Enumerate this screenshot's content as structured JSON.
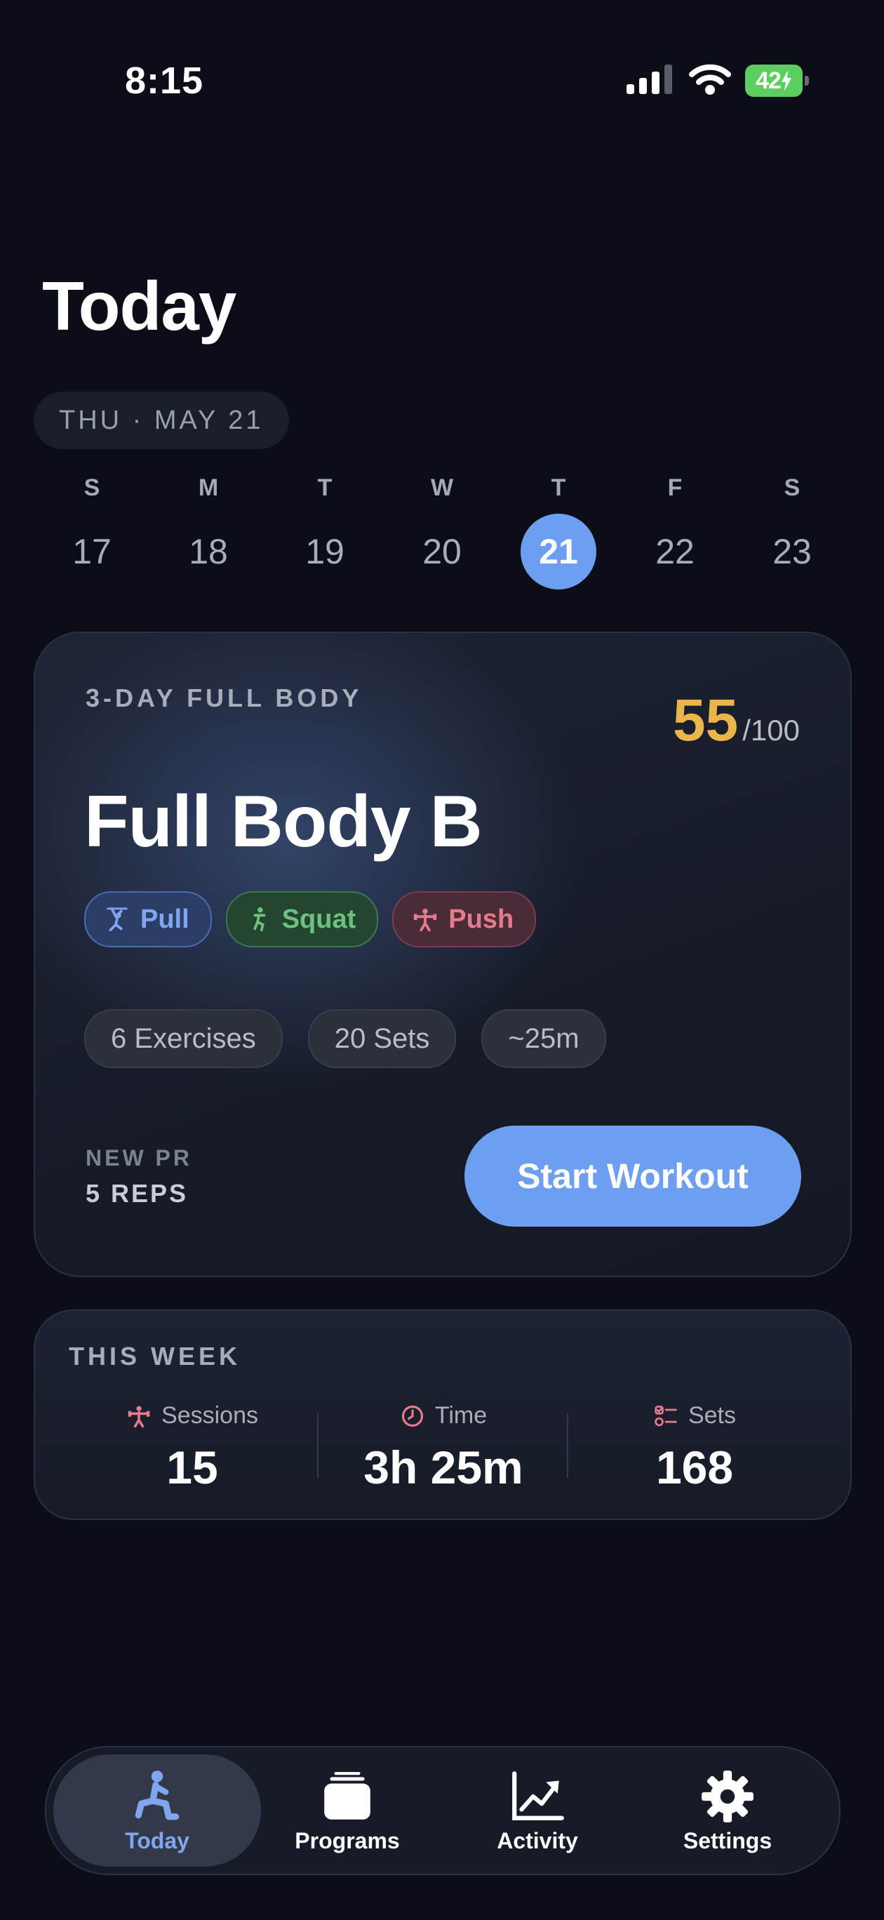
{
  "status_bar": {
    "time": "8:15",
    "battery": "42"
  },
  "header": {
    "title": "Today",
    "date_label": "THU · MAY 21"
  },
  "week_strip": {
    "days": [
      {
        "letter": "S",
        "num": "17"
      },
      {
        "letter": "M",
        "num": "18"
      },
      {
        "letter": "T",
        "num": "19"
      },
      {
        "letter": "W",
        "num": "20"
      },
      {
        "letter": "T",
        "num": "21"
      },
      {
        "letter": "F",
        "num": "22"
      },
      {
        "letter": "S",
        "num": "23"
      }
    ],
    "selected_index": 4
  },
  "workout": {
    "program": "3-DAY FULL BODY",
    "score": "55",
    "score_total": "/100",
    "title": "Full Body B",
    "tags": {
      "pull": "Pull",
      "squat": "Squat",
      "push": "Push"
    },
    "stats": {
      "exercises": "6 Exercises",
      "sets": "20 Sets",
      "duration": "~25m"
    },
    "pr_label": "NEW PR",
    "pr_value": "5 REPS",
    "start_label": "Start Workout"
  },
  "this_week": {
    "title": "THIS WEEK",
    "sessions_label": "Sessions",
    "sessions_value": "15",
    "time_label": "Time",
    "time_value": "3h 25m",
    "sets_label": "Sets",
    "sets_value": "168"
  },
  "tab_bar": {
    "today": "Today",
    "programs": "Programs",
    "activity": "Activity",
    "settings": "Settings"
  },
  "colors": {
    "accent": "#6d9ef0",
    "score": "#eab64b",
    "pull": "#7fa6ee",
    "squat": "#6cc27c",
    "push": "#e57b8b",
    "background": "#0b0e17"
  }
}
